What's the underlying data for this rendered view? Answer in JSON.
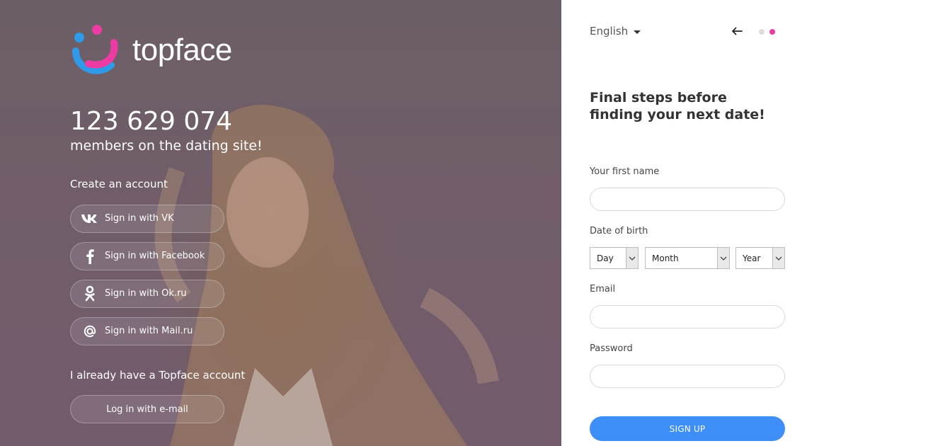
{
  "brand": {
    "name": "topface",
    "colors": {
      "blue": "#2f9be8",
      "pink": "#ec3ca4",
      "accent": "#3d8ef7"
    }
  },
  "hero": {
    "members_count": "123 629 074",
    "members_text": "members on the dating site!",
    "create_title": "Create an account",
    "social_buttons": [
      {
        "icon": "vk-icon",
        "label": "Sign in with VK"
      },
      {
        "icon": "facebook-icon",
        "label": "Sign in with Facebook"
      },
      {
        "icon": "ok-icon",
        "label": "Sign in with Ok.ru"
      },
      {
        "icon": "mail-icon",
        "label": "Sign in with Mail.ru"
      }
    ],
    "have_account": "I already have a Topface account",
    "email_login_label": "Log in with e-mail"
  },
  "panel": {
    "language": "English",
    "progress": {
      "current_step": 2,
      "total_steps": 2
    },
    "headline": "Final steps before finding your next date!",
    "form": {
      "first_name_label": "Your first name",
      "first_name_value": "",
      "dob_label": "Date of birth",
      "day_value": "Day",
      "month_value": "Month",
      "year_value": "Year",
      "email_label": "Email",
      "email_value": "",
      "password_label": "Password",
      "password_value": "",
      "signup_label": "SIGN UP"
    }
  }
}
